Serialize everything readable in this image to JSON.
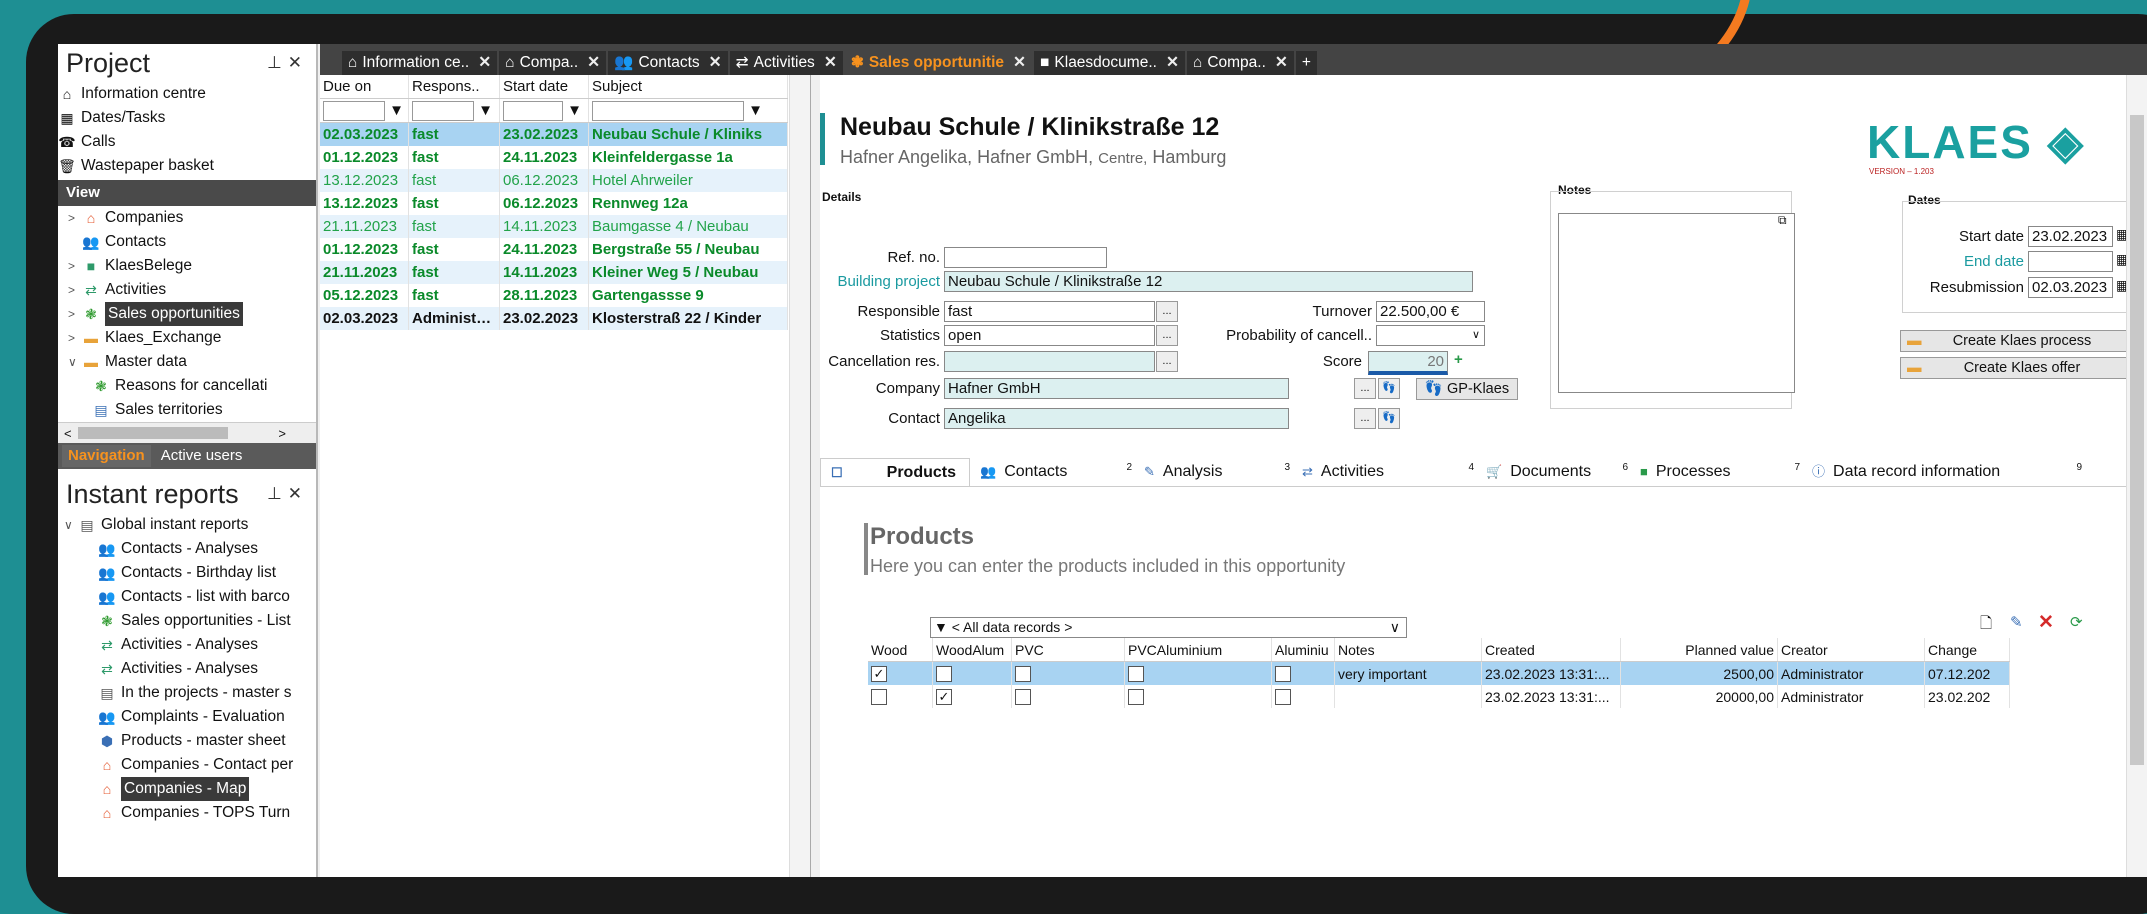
{
  "left": {
    "project_title": "Project",
    "project_items": [
      {
        "icon": "⌂",
        "label": "Information centre"
      },
      {
        "icon": "▦",
        "label": "Dates/Tasks"
      },
      {
        "icon": "☎",
        "label": "Calls"
      },
      {
        "icon": "🗑",
        "label": "Wastepaper basket"
      }
    ],
    "view_title": "View",
    "view_items": [
      {
        "label": "Companies"
      },
      {
        "label": "Contacts"
      },
      {
        "label": "KlaesBelege"
      },
      {
        "label": "Activities"
      },
      {
        "label": "Sales opportunities"
      },
      {
        "label": "Klaes_Exchange"
      },
      {
        "label": "Master data"
      },
      {
        "label": "Reasons for cancellati"
      },
      {
        "label": "Sales territories"
      }
    ],
    "nav_tabs": [
      "Navigation",
      "Active users"
    ],
    "reports_title": "Instant reports",
    "reports_items": [
      "Global instant reports",
      "Contacts - Analyses",
      "Contacts - Birthday list",
      "Contacts - list with barco",
      "Sales opportunities - List",
      "Activities - Analyses",
      "Activities - Analyses",
      "In the projects - master s",
      "Complaints - Evaluation",
      "Products - master sheet",
      "Companies - Contact per",
      "Companies - Map",
      "Companies - TOPS Turn"
    ]
  },
  "doc_tabs": [
    {
      "label": "Information ce..",
      "icon": "⌂"
    },
    {
      "label": "Compa..",
      "icon": "⌂"
    },
    {
      "label": "Contacts",
      "icon": "👥"
    },
    {
      "label": "Activities",
      "icon": "⇄"
    },
    {
      "label": "Sales opportunitie",
      "icon": "❃"
    },
    {
      "label": "Klaesdocume..",
      "icon": "■"
    },
    {
      "label": "Compa..",
      "icon": "⌂"
    }
  ],
  "list": {
    "headers": [
      "Due on",
      "Respons..",
      "Start date",
      "Subject"
    ],
    "rows": [
      {
        "due": "02.03.2023",
        "resp": "fast",
        "start": "23.02.2023",
        "subj": "Neubau Schule / Kliniks",
        "style": "green"
      },
      {
        "due": "01.12.2023",
        "resp": "fast",
        "start": "24.11.2023",
        "subj": "Kleinfeldergasse 1a",
        "style": "green"
      },
      {
        "due": "13.12.2023",
        "resp": "fast",
        "start": "06.12.2023",
        "subj": "Hotel Ahrweiler",
        "style": "lgreen"
      },
      {
        "due": "13.12.2023",
        "resp": "fast",
        "start": "06.12.2023",
        "subj": "Rennweg 12a",
        "style": "green"
      },
      {
        "due": "21.11.2023",
        "resp": "fast",
        "start": "14.11.2023",
        "subj": "Baumgasse 4 / Neubau",
        "style": "lgreen"
      },
      {
        "due": "01.12.2023",
        "resp": "fast",
        "start": "24.11.2023",
        "subj": "Bergstraße 55 / Neubau",
        "style": "green"
      },
      {
        "due": "21.11.2023",
        "resp": "fast",
        "start": "14.11.2023",
        "subj": "Kleiner Weg 5 / Neubau",
        "style": "green"
      },
      {
        "due": "05.12.2023",
        "resp": "fast",
        "start": "28.11.2023",
        "subj": "Gartengassse 9",
        "style": "green"
      },
      {
        "due": "02.03.2023",
        "resp": "Administ…",
        "start": "23.02.2023",
        "subj": "Klosterstraß 22 / Kinder",
        "style": "blk"
      }
    ]
  },
  "detail": {
    "title": "Neubau Schule / Klinikstraße 12",
    "subtitle_main": "Hafner Angelika, Hafner GmbH,",
    "subtitle_small": "Centre,",
    "subtitle_city": "Hamburg",
    "logo": "KLAES",
    "logo_version": "VERSION – 1.203",
    "details_label": "Details",
    "notes_label": "Notes",
    "dates_label": "Dates",
    "ref_no_label": "Ref. no.",
    "ref_no": "",
    "building_project_label": "Building project",
    "building_project": "Neubau Schule / Klinikstraße 12",
    "responsible_label": "Responsible",
    "responsible": "fast",
    "turnover_label": "Turnover",
    "turnover": "22.500,00 €",
    "statistics_label": "Statistics",
    "statistics": "open",
    "prob_label": "Probability of cancell..",
    "prob": "",
    "cancel_label": "Cancellation res.",
    "cancel": "",
    "score_label": "Score",
    "score": "20",
    "company_label": "Company",
    "company": "Hafner GmbH",
    "gp_button": "GP-Klaes",
    "contact_label": "Contact",
    "contact": "Angelika",
    "start_date_label": "Start date",
    "start_date": "23.02.2023",
    "end_date_label": "End date",
    "end_date": "",
    "resub_label": "Resubmission",
    "resub": "02.03.2023",
    "btn_process": "Create Klaes process",
    "btn_offer": "Create Klaes offer",
    "subtabs": [
      {
        "label": "Products",
        "num": ""
      },
      {
        "label": "Contacts",
        "num": "2"
      },
      {
        "label": "Analysis",
        "num": "3"
      },
      {
        "label": "Activities",
        "num": "4"
      },
      {
        "label": "Documents",
        "num": "6"
      },
      {
        "label": "Processes",
        "num": "7"
      },
      {
        "label": "Data record information",
        "num": "9"
      }
    ],
    "products_heading": "Products",
    "products_sub": "Here you can enter the products included in this opportunity",
    "filter_value": "< All data records  >",
    "prod_headers": [
      "Wood",
      "WoodAlum",
      "PVC",
      "PVCAluminium",
      "Aluminiu",
      "Notes",
      "Created",
      "Planned value",
      "Creator",
      "Change"
    ],
    "prod_rows": [
      {
        "wood": true,
        "woodalum": false,
        "pvc": false,
        "pvcalu": false,
        "alu": false,
        "notes": "very important",
        "created": "23.02.2023 13:31:...",
        "planned": "2500,00",
        "creator": "Administrator",
        "change": "07.12.202"
      },
      {
        "wood": false,
        "woodalum": true,
        "pvc": false,
        "pvcalu": false,
        "alu": false,
        "notes": "",
        "created": "23.02.2023 13:31:...",
        "planned": "20000,00",
        "creator": "Administrator",
        "change": "23.02.202"
      }
    ]
  },
  "colors": {
    "accent": "#f7921e",
    "teal": "#1e8f93",
    "selected_row": "#a8d3f2"
  }
}
